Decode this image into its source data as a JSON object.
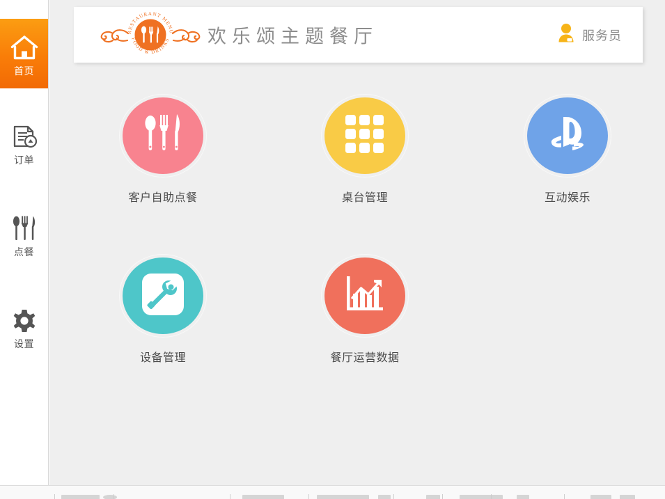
{
  "sidebar": {
    "items": [
      {
        "label": "首页",
        "icon": "home-icon",
        "key": "home",
        "active": true
      },
      {
        "label": "订单",
        "icon": "order-document-icon",
        "key": "orders",
        "active": false
      },
      {
        "label": "点餐",
        "icon": "cutlery-icon",
        "key": "ordering",
        "active": false
      },
      {
        "label": "设置",
        "icon": "gear-icon",
        "key": "settings",
        "active": false
      }
    ],
    "active_background": "#f97d08"
  },
  "header": {
    "title": "欢乐颂主题餐厅",
    "logo": {
      "icon": "restaurant-menu-badge-logo",
      "arc_top_text": "RESTAURANT MENU",
      "arc_bottom_text": "FOOD & DRINKS",
      "color": "#ef7122"
    },
    "user": {
      "name": "服务员",
      "icon": "user-avatar-icon",
      "color": "#f7b418"
    }
  },
  "main": {
    "tiles": [
      {
        "label": "客户自助点餐",
        "icon": "cutlery-spoon-fork-knife-icon",
        "color": "#f8838f",
        "key": "self-order"
      },
      {
        "label": "桌台管理",
        "icon": "grid-3x3-icon",
        "color": "#f9cb46",
        "key": "table-management"
      },
      {
        "label": "互动娱乐",
        "icon": "playstation-logo-icon",
        "color": "#6fa3e8",
        "key": "entertainment"
      },
      {
        "label": "设备管理",
        "icon": "wrench-icon",
        "color": "#4ec6c9",
        "key": "device-management"
      },
      {
        "label": "餐厅运营数据",
        "icon": "bar-chart-trend-icon",
        "color": "#f0705c",
        "key": "operations-data"
      }
    ]
  },
  "taskbar": {
    "visible_fragment": true
  }
}
